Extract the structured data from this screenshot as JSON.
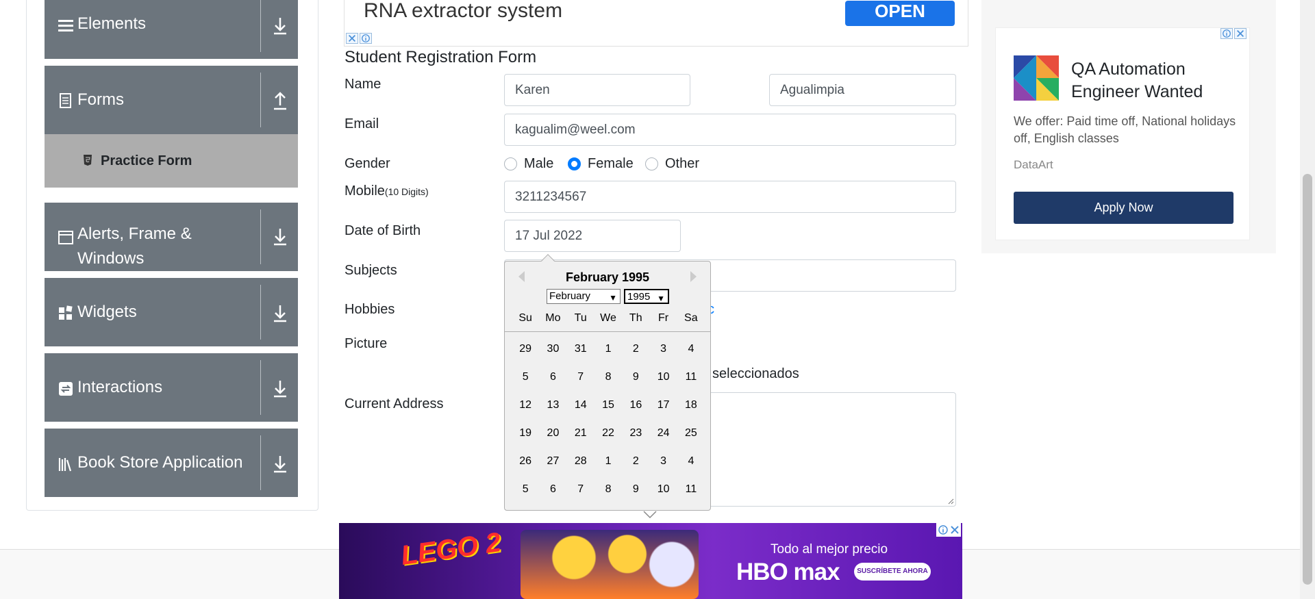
{
  "sidebar": {
    "groups": [
      {
        "label": "Elements",
        "icon": "list-icon",
        "arrow": "download-icon"
      },
      {
        "label": "Forms",
        "icon": "document-icon",
        "arrow": "upload-icon"
      },
      {
        "label": "Alerts, Frame & Windows",
        "icon": "window-icon",
        "arrow": "download-icon"
      },
      {
        "label": "Widgets",
        "icon": "widgets-icon",
        "arrow": "download-icon"
      },
      {
        "label": "Interactions",
        "icon": "interactions-icon",
        "arrow": "download-icon"
      },
      {
        "label": "Book Store Application",
        "icon": "books-icon",
        "arrow": "download-icon"
      }
    ],
    "active_item": "Practice Form"
  },
  "top_ad": {
    "text": "RNA extractor system",
    "button": "OPEN"
  },
  "form": {
    "title": "Student Registration Form",
    "labels": {
      "name": "Name",
      "email": "Email",
      "gender": "Gender",
      "mobile": "Mobile",
      "mobile_hint": "(10 Digits)",
      "dob": "Date of Birth",
      "subjects": "Subjects",
      "hobbies": "Hobbies",
      "picture": "Picture",
      "address": "Current Address"
    },
    "first_name": "Karen",
    "last_name": "Agualimpia",
    "email": "kagualim@weel.com",
    "gender_options": [
      "Male",
      "Female",
      "Other"
    ],
    "gender_selected": "Female",
    "mobile": "3211234567",
    "dob": "17 Jul 2022",
    "hobbies_partial": "c",
    "picture_status_partial": "seleccionados"
  },
  "calendar": {
    "title": "February 1995",
    "month_select": "February",
    "year_select": "1995",
    "day_names": [
      "Su",
      "Mo",
      "Tu",
      "We",
      "Th",
      "Fr",
      "Sa"
    ],
    "days": [
      "29",
      "30",
      "31",
      "1",
      "2",
      "3",
      "4",
      "5",
      "6",
      "7",
      "8",
      "9",
      "10",
      "11",
      "12",
      "13",
      "14",
      "15",
      "16",
      "17",
      "18",
      "19",
      "20",
      "21",
      "22",
      "23",
      "24",
      "25",
      "26",
      "27",
      "28",
      "1",
      "2",
      "3",
      "4",
      "5",
      "6",
      "7",
      "8",
      "9",
      "10",
      "11"
    ]
  },
  "right_ad": {
    "title": "QA Automation Engineer Wanted",
    "body": "We offer: Paid time off, National holidays off, English classes",
    "brand": "DataArt",
    "button": "Apply Now"
  },
  "bottom_ad": {
    "promo": "Todo al mejor precio",
    "brand": "HBO max",
    "cta": "SUSCRÍBETE AHORA"
  }
}
